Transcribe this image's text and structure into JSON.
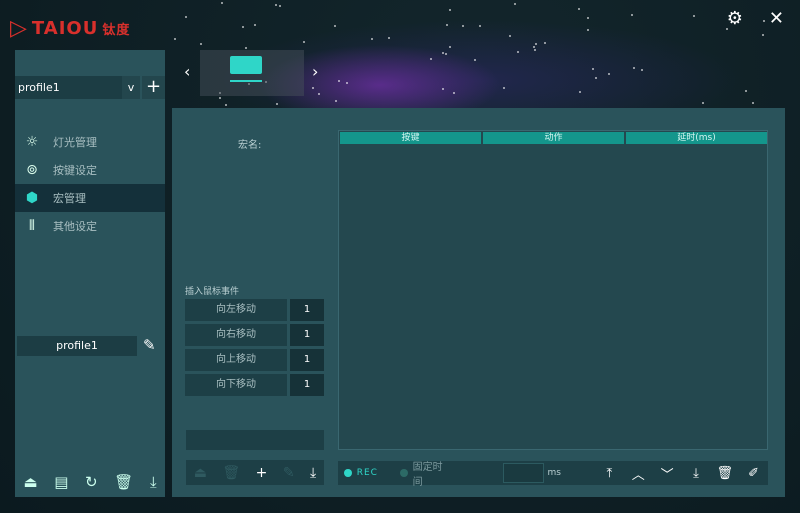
{
  "app": {
    "brand": "TAIOU",
    "brand_cn": "钛度"
  },
  "window": {
    "settings_icon": "gear-icon",
    "close_icon": "close-icon"
  },
  "sidebar": {
    "profile_selected": "profile1",
    "nav": [
      {
        "label": "灯光管理",
        "icon": "bulb-icon"
      },
      {
        "label": "按键设定",
        "icon": "keys-icon"
      },
      {
        "label": "宏管理",
        "icon": "box-icon",
        "selected": true
      },
      {
        "label": "其他设定",
        "icon": "sliders-icon"
      }
    ],
    "profile_name": "profile1"
  },
  "macro": {
    "name_label": "宏名:",
    "columns": [
      "按键",
      "动作",
      "延时(ms)"
    ],
    "insert_mouse_label": "插入鼠标事件",
    "mouse_events": [
      {
        "label": "向左移动",
        "value": "1"
      },
      {
        "label": "向右移动",
        "value": "1"
      },
      {
        "label": "向上移动",
        "value": "1"
      },
      {
        "label": "向下移动",
        "value": "1"
      }
    ],
    "rec_label": "REC",
    "fixed_time_label": "固定时间",
    "ms_label": "ms",
    "colors": {
      "accent": "#14968c",
      "rec": "#2fd6c8"
    }
  }
}
